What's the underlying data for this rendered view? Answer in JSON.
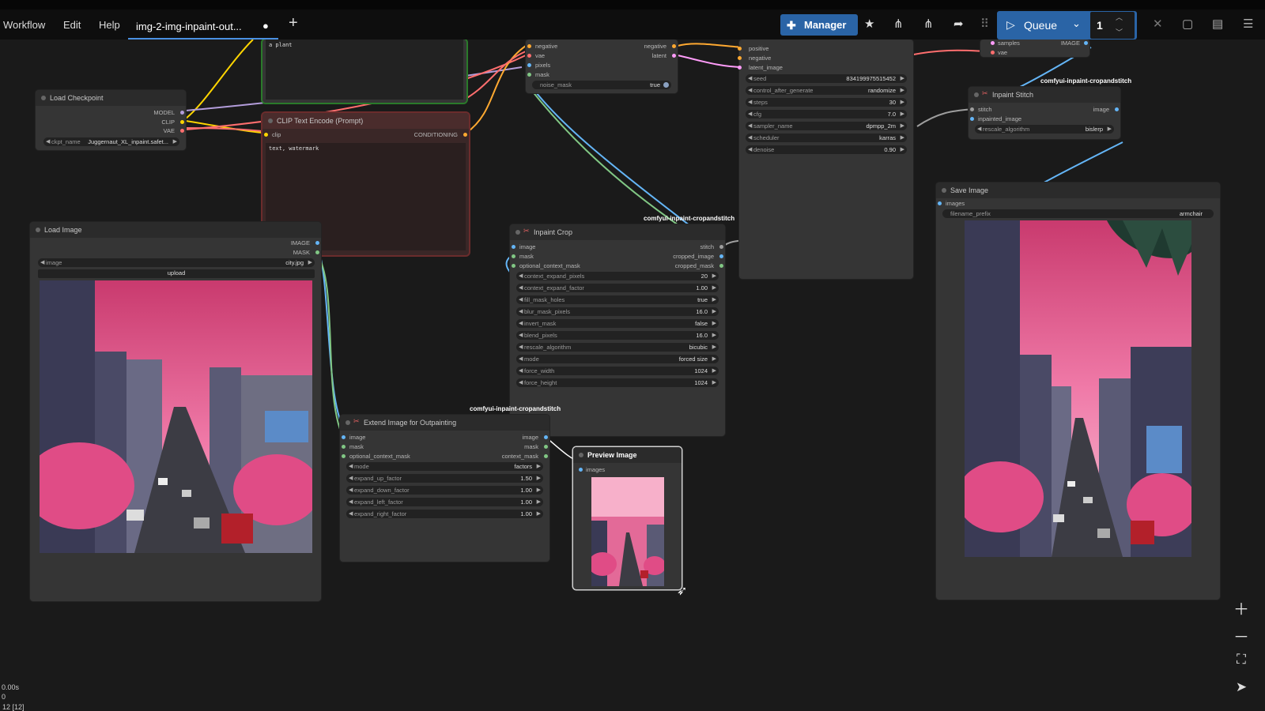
{
  "menu": {
    "workflow": "Workflow",
    "edit": "Edit",
    "help": "Help"
  },
  "tab": {
    "title": "img-2-img-inpaint-out...",
    "modified": "●",
    "add": "+"
  },
  "toolbar": {
    "manager": "Manager",
    "queue": "Queue",
    "queue_count": "1"
  },
  "icons": [
    "puzzle-icon",
    "star-icon",
    "a11y-icon",
    "share-icon",
    "grip-icon",
    "play-icon",
    "chevron-down-icon",
    "close-icon",
    "layout-icon",
    "panel-icon",
    "hamburger-icon"
  ],
  "nodes": {
    "load_checkpoint": {
      "title": "Load Checkpoint",
      "outputs": [
        "MODEL",
        "CLIP",
        "VAE"
      ],
      "widget_label": "ckpt_name",
      "widget_value": "Juggernaut_XL_inpaint.safet..."
    },
    "clip_text_positive": {
      "text": "a plant"
    },
    "clip_text_encode": {
      "title": "CLIP Text Encode (Prompt)",
      "input": "clip",
      "output": "CONDITIONING",
      "text": "text, watermark"
    },
    "load_image": {
      "title": "Load Image",
      "outputs": [
        "IMAGE",
        "MASK"
      ],
      "widget_label": "image",
      "widget_value": "city.jpg",
      "upload": "upload"
    },
    "inpaint_model_cond": {
      "inputs": [
        "negative",
        "vae",
        "pixels",
        "mask"
      ],
      "outputs": [
        "negative",
        "latent"
      ],
      "widget_label": "noise_mask",
      "widget_value": "true"
    },
    "ksampler": {
      "inputs": [
        "positive",
        "negative",
        "latent_image"
      ],
      "widgets": [
        {
          "label": "seed",
          "value": "834199975515452"
        },
        {
          "label": "control_after_generate",
          "value": "randomize"
        },
        {
          "label": "steps",
          "value": "30"
        },
        {
          "label": "cfg",
          "value": "7.0"
        },
        {
          "label": "sampler_name",
          "value": "dpmpp_2m"
        },
        {
          "label": "scheduler",
          "value": "karras"
        },
        {
          "label": "denoise",
          "value": "0.90"
        }
      ]
    },
    "vae_decode": {
      "inputs": [
        "samples",
        "vae"
      ],
      "output": "IMAGE"
    },
    "inpaint_stitch": {
      "title": "Inpaint Stitch",
      "badge": "comfyui-inpaint-cropandstitch",
      "inputs": [
        "stitch",
        "inpainted_image"
      ],
      "output": "image",
      "widget_label": "rescale_algorithm",
      "widget_value": "bislerp"
    },
    "save_image": {
      "title": "Save Image",
      "input": "images",
      "widget_label": "filename_prefix",
      "widget_value": "armchair"
    },
    "inpaint_crop": {
      "title": "Inpaint Crop",
      "badge": "comfyui-inpaint-cropandstitch",
      "inputs": [
        "image",
        "mask",
        "optional_context_mask"
      ],
      "outputs": [
        "stitch",
        "cropped_image",
        "cropped_mask"
      ],
      "widgets": [
        {
          "label": "context_expand_pixels",
          "value": "20"
        },
        {
          "label": "context_expand_factor",
          "value": "1.00"
        },
        {
          "label": "fill_mask_holes",
          "value": "true"
        },
        {
          "label": "blur_mask_pixels",
          "value": "16.0"
        },
        {
          "label": "invert_mask",
          "value": "false"
        },
        {
          "label": "blend_pixels",
          "value": "16.0"
        },
        {
          "label": "rescale_algorithm",
          "value": "bicubic"
        },
        {
          "label": "mode",
          "value": "forced size"
        },
        {
          "label": "force_width",
          "value": "1024"
        },
        {
          "label": "force_height",
          "value": "1024"
        }
      ]
    },
    "extend_image": {
      "title": "Extend Image for Outpainting",
      "badge": "comfyui-inpaint-cropandstitch",
      "inputs": [
        "image",
        "mask",
        "optional_context_mask"
      ],
      "outputs": [
        "image",
        "mask",
        "context_mask"
      ],
      "widgets": [
        {
          "label": "mode",
          "value": "factors"
        },
        {
          "label": "expand_up_factor",
          "value": "1.50"
        },
        {
          "label": "expand_down_factor",
          "value": "1.00"
        },
        {
          "label": "expand_left_factor",
          "value": "1.00"
        },
        {
          "label": "expand_right_factor",
          "value": "1.00"
        }
      ]
    },
    "preview_image": {
      "title": "Preview Image",
      "input": "images"
    }
  },
  "status": {
    "time": "0.00s",
    "queue": "0",
    "nodes": ": 12 [12]"
  },
  "colors": {
    "accent": "#2a64a6",
    "model": "#b39ddb",
    "clip": "#ffd500",
    "vae": "#ff6e6e",
    "conditioning": "#ffa931",
    "image": "#64b5f6",
    "mask": "#81c784",
    "latent": "#ff9cf9"
  }
}
